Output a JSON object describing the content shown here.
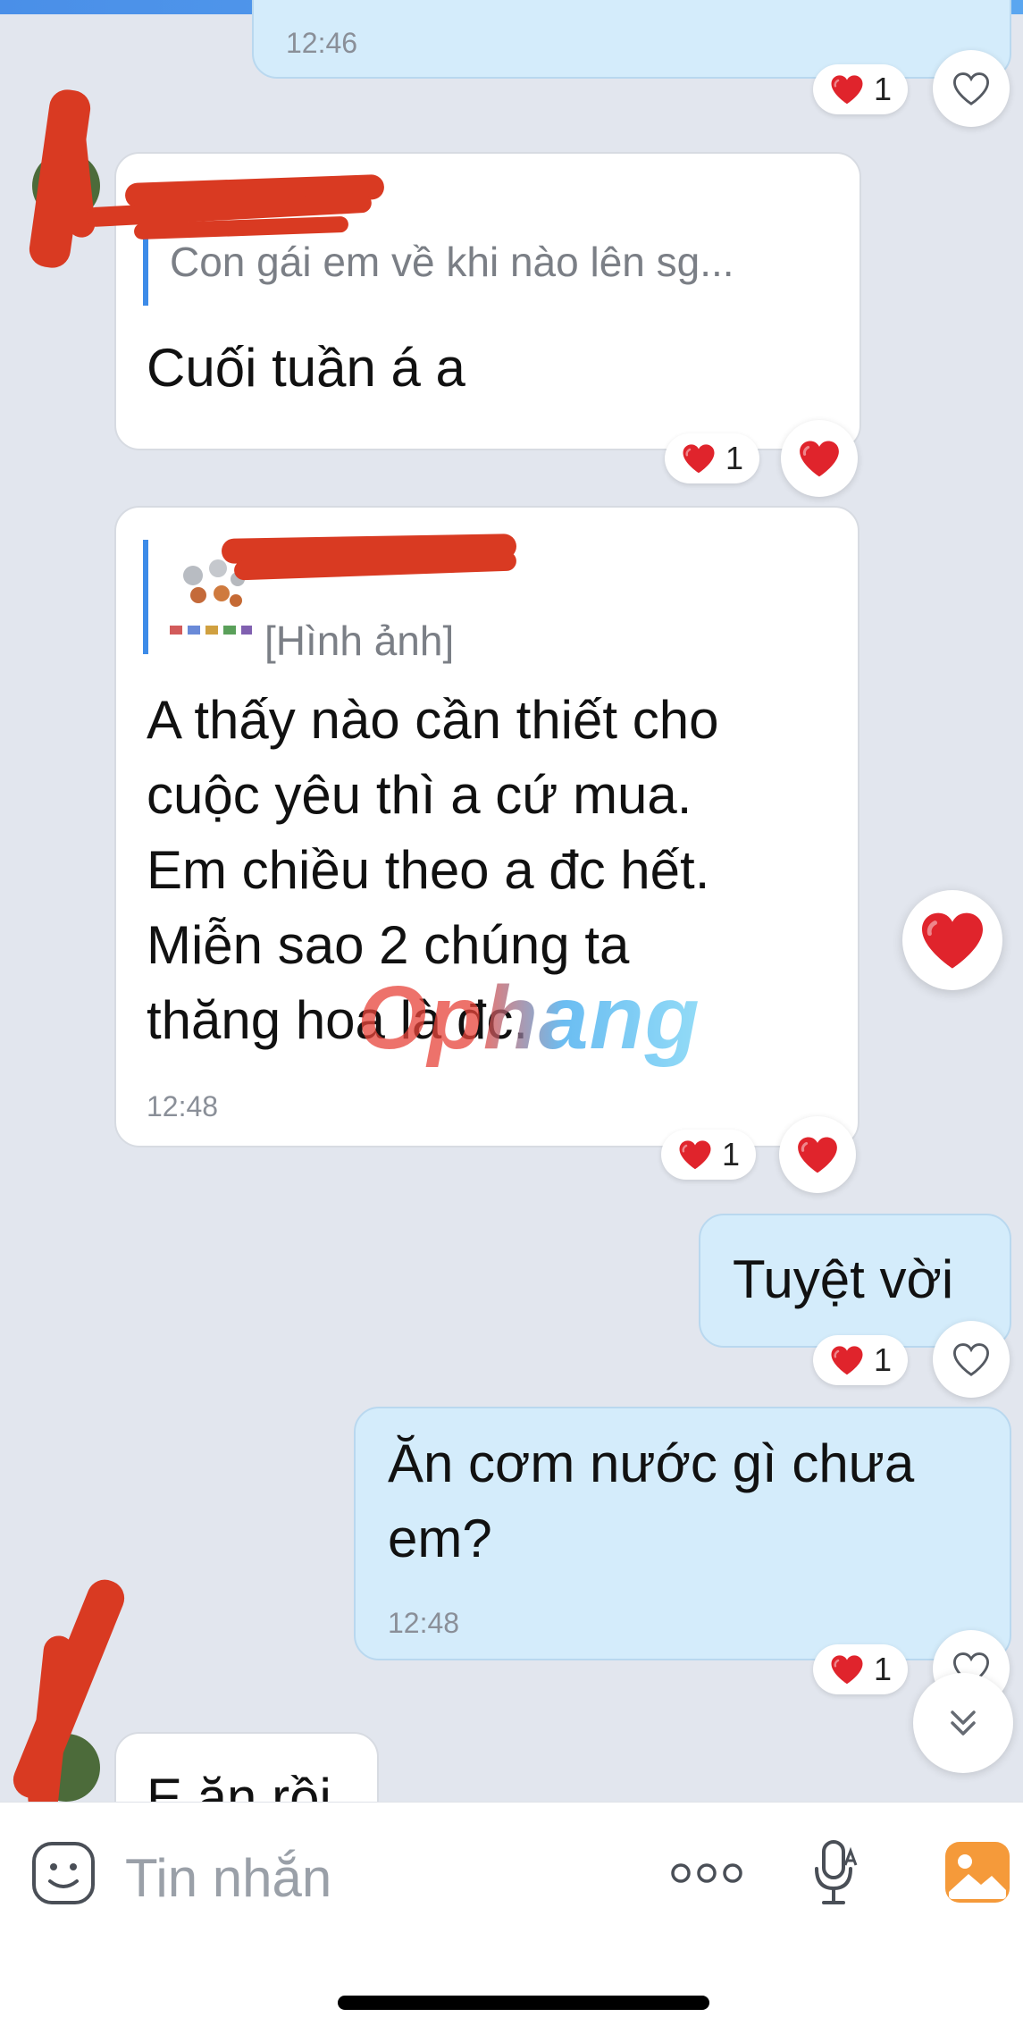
{
  "messages": [
    {
      "id": "m1",
      "text": "",
      "time": "12:46",
      "reaction_count": "1"
    },
    {
      "id": "m2",
      "quote": "Con gái em về khi nào lên sg...",
      "text": "Cuối tuần á a",
      "reaction_count": "1"
    },
    {
      "id": "m3",
      "quote": "[Hình ảnh]",
      "text_lines": [
        "A thấy nào cần thiết cho",
        "cuộc yêu thì a cứ mua.",
        "Em chiều theo a đc hết.",
        "Miễn sao 2 chúng ta",
        "thăng hoa là đc."
      ],
      "time": "12:48",
      "reaction_count": "1"
    },
    {
      "id": "m4",
      "text": "Tuyệt vời",
      "reaction_count": "1"
    },
    {
      "id": "m5",
      "text_lines": [
        "Ăn cơm nước gì chưa",
        "em?"
      ],
      "time": "12:48",
      "reaction_count": "1"
    },
    {
      "id": "m6",
      "text": "E ăn rồi"
    }
  ],
  "watermark": "Ophang",
  "composer": {
    "placeholder": "Tin nhắn"
  },
  "icons": {
    "heart": "heart-icon",
    "heart_outline": "heart-outline-icon",
    "sticker": "sticker-icon",
    "more": "more-dots-icon",
    "mic": "mic-icon",
    "image": "image-icon",
    "scroll_down": "chevron-double-down-icon"
  },
  "colors": {
    "accent": "#3d8be8",
    "heart": "#e0242c",
    "outgoing_bubble": "#d4ecfb",
    "incoming_bubble": "#ffffff",
    "redaction": "#d93a22"
  }
}
